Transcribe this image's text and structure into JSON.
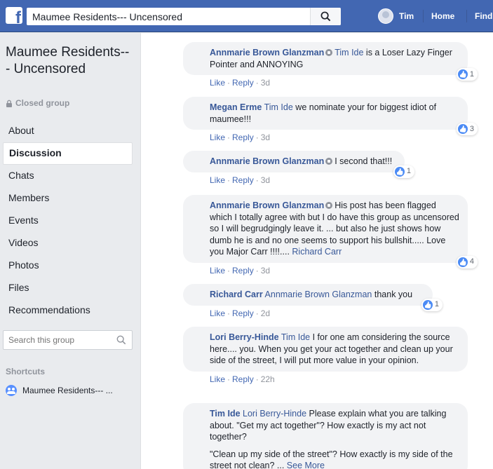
{
  "topbar": {
    "search_value": "Maumee Residents--- Uncensored",
    "user_name": "Tim",
    "nav_home": "Home",
    "nav_find": "Find",
    "brand_color": "#4267b2"
  },
  "group": {
    "title": "Maumee Residents--- Uncensored",
    "status": "Closed group"
  },
  "menu": [
    {
      "label": "About"
    },
    {
      "label": "Discussion",
      "active": true
    },
    {
      "label": "Chats"
    },
    {
      "label": "Members"
    },
    {
      "label": "Events"
    },
    {
      "label": "Videos"
    },
    {
      "label": "Photos"
    },
    {
      "label": "Files"
    },
    {
      "label": "Recommendations"
    }
  ],
  "group_search": {
    "placeholder": "Search this group"
  },
  "shortcuts": {
    "heading": "Shortcuts",
    "items": [
      {
        "label": "Maumee Residents--- ..."
      }
    ]
  },
  "actions": {
    "like": "Like",
    "reply": "Reply",
    "sep": "·"
  },
  "comments": [
    {
      "author": "Annmarie Brown Glanzman",
      "admin": true,
      "mention": "Tim Ide",
      "text": " is a Loser Lazy Finger Pointer and ANNOYING",
      "time": "3d",
      "likes": "1",
      "avatar_color": "#a89a86"
    },
    {
      "author": "Megan Erme",
      "admin": false,
      "mention": "Tim Ide",
      "text": " we nominate your for biggest idiot of maumee!!!",
      "time": "3d",
      "likes": "3",
      "avatar_color": "#7a5d66"
    },
    {
      "author": "Annmarie Brown Glanzman",
      "admin": true,
      "mention": "",
      "text": "I second that!!!",
      "time": "3d",
      "likes": "1",
      "avatar_color": "#a89a86"
    },
    {
      "author": "Annmarie Brown Glanzman",
      "admin": true,
      "mention": "",
      "text": "His post has been flagged which I totally agree with but I do have this group as uncensored so I will begrudgingly leave it. ... but also he just shows how dumb he is and no one seems to support his bullshit..... Love you Major Carr !!!!.... ",
      "mention_end": "Richard Carr",
      "time": "3d",
      "likes": "4",
      "avatar_color": "#a89a86"
    },
    {
      "author": "Richard Carr",
      "admin": false,
      "mention": "Annmarie Brown Glanzman",
      "text": " thank you",
      "time": "2d",
      "likes": "1",
      "avatar_color": "#7d8a6a"
    },
    {
      "author": "Lori Berry-Hinde",
      "admin": false,
      "mention": "Tim Ide",
      "text": " I for one am considering the source here.... you. When you get your act together and clean up your side of the street, I will put more value in your opinion.",
      "time": "22h",
      "likes": "",
      "avatar_color": "#b04a3a"
    },
    {
      "author": "Tim Ide",
      "admin": false,
      "mention": "Lori Berry-Hinde",
      "text": " Please explain what you are talking about. \"Get my act together\"? How exactly is my act not together?",
      "text2": "\"Clean up my side of the street\"? How exactly is my side of the street not clean? ... ",
      "see_more": "See More",
      "time": "",
      "likes": "",
      "avatar_color": "#dfe3ee"
    }
  ]
}
